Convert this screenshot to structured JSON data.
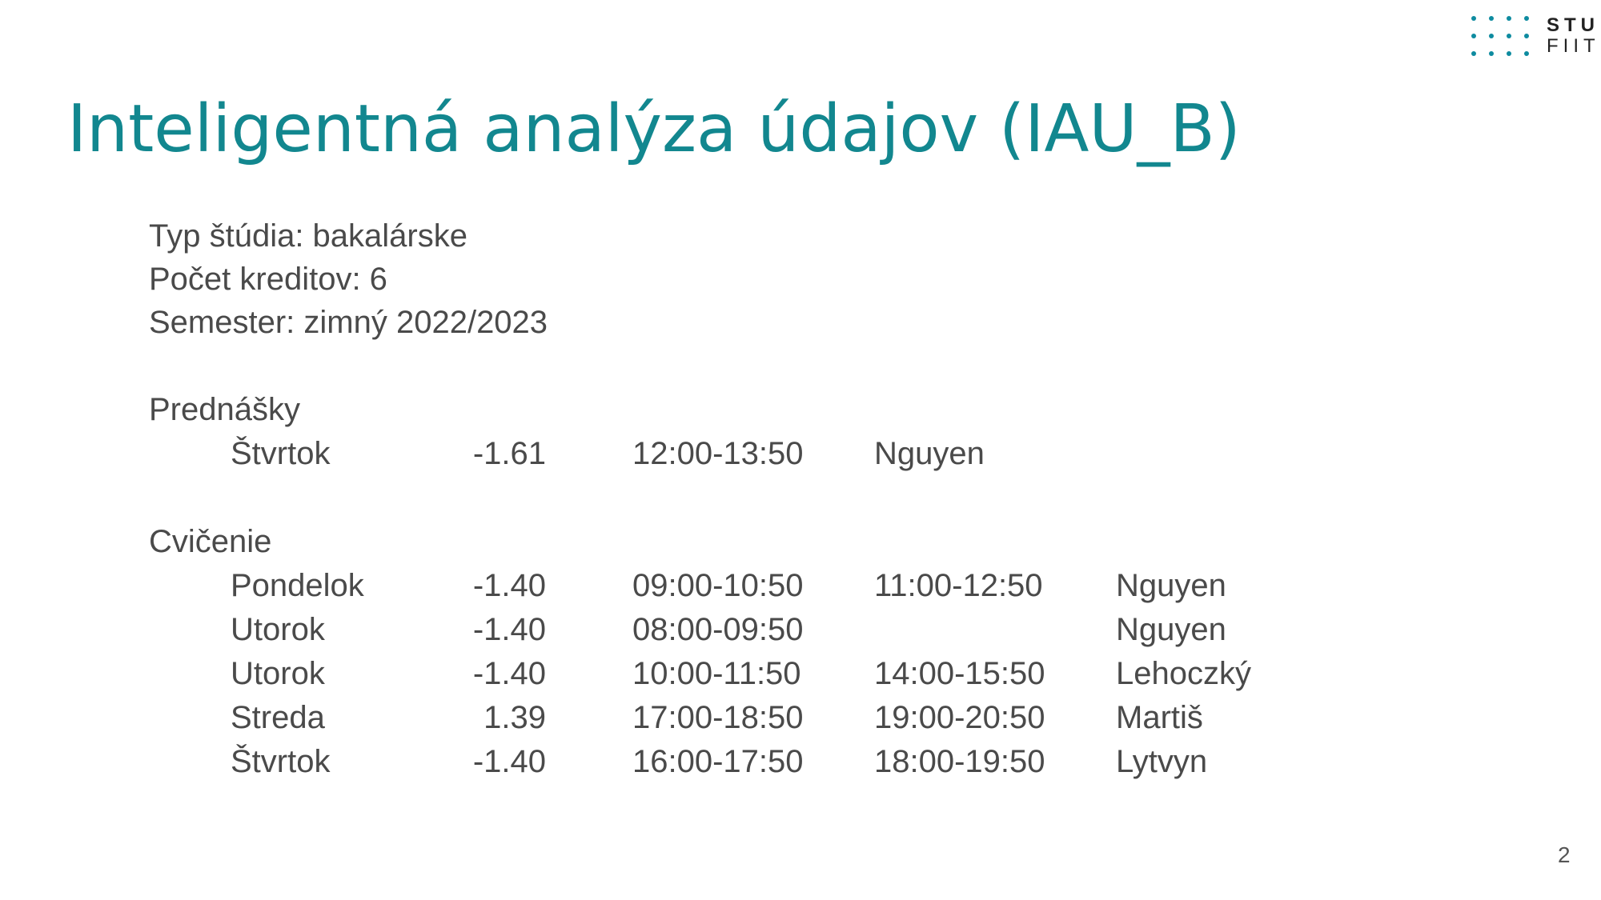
{
  "logo": {
    "line1": "STU",
    "line2": "FIIT"
  },
  "title": "Inteligentná analýza údajov (IAU_B)",
  "meta": [
    "Typ štúdia: bakalárske",
    "Počet kreditov: 6",
    "Semester: zimný 2022/2023"
  ],
  "lectures": {
    "label": "Prednášky",
    "rows": [
      {
        "day": "Štvrtok",
        "room": "-1.61",
        "time": "12:00-13:50",
        "teacher": "Nguyen"
      }
    ]
  },
  "exercises": {
    "label": "Cvičenie",
    "rows": [
      {
        "day": "Pondelok",
        "room": "-1.40",
        "time1": "09:00-10:50",
        "time2": "11:00-12:50",
        "teacher": "Nguyen"
      },
      {
        "day": "Utorok",
        "room": "-1.40",
        "time1": "08:00-09:50",
        "time2": "",
        "teacher": "Nguyen"
      },
      {
        "day": "Utorok",
        "room": "-1.40",
        "time1": "10:00-11:50",
        "time2": "14:00-15:50",
        "teacher": "Lehoczký"
      },
      {
        "day": "Streda",
        "room": "1.39",
        "time1": "17:00-18:50",
        "time2": "19:00-20:50",
        "teacher": "Martiš"
      },
      {
        "day": "Štvrtok",
        "room": "-1.40",
        "time1": "16:00-17:50",
        "time2": "18:00-19:50",
        "teacher": "Lytvyn"
      }
    ]
  },
  "page_number": "2",
  "colors": {
    "accent": "#12878f",
    "text": "#4a4a4a",
    "logo_dots": "#0e8ba0"
  }
}
